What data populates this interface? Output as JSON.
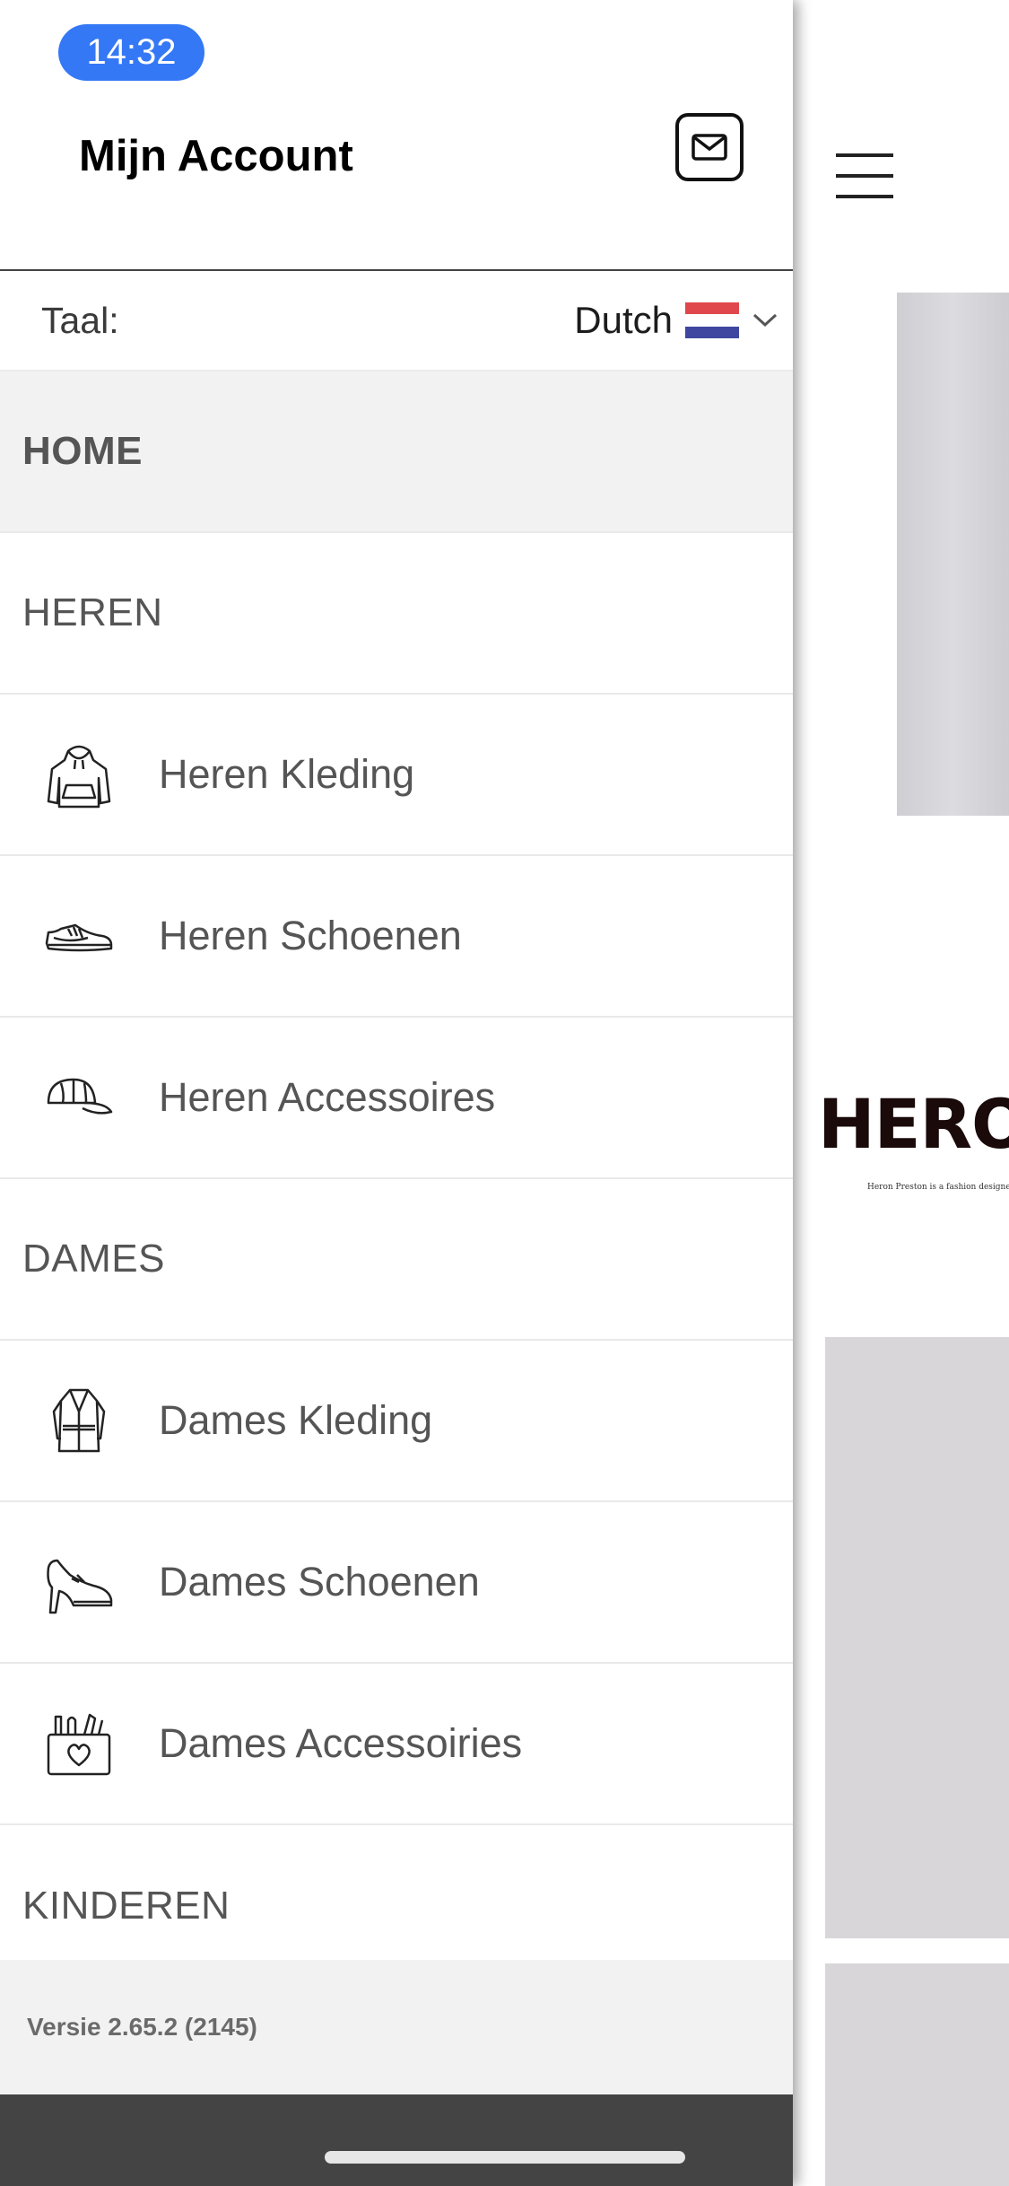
{
  "status_bar": {
    "time": "14:32"
  },
  "drawer": {
    "title": "Mijn Account",
    "language": {
      "label": "Taal:",
      "value": "Dutch",
      "flag": "nl-flag-icon"
    },
    "menu": {
      "home": "HOME",
      "heren": "HEREN",
      "heren_kleding": "Heren Kleding",
      "heren_schoenen": "Heren Schoenen",
      "heren_accessoires": "Heren Accessoires",
      "dames": "DAMES",
      "dames_kleding": "Dames Kleding",
      "dames_schoenen": "Dames Schoenen",
      "dames_accessoiries": "Dames Accessoiries",
      "kinderen": "KINDEREN"
    },
    "version": "Versie 2.65.2 (2145)"
  },
  "main": {
    "brand": "HERO",
    "tagline": "Heron Preston is a fashion designer who"
  },
  "colors": {
    "accent": "#3478f6",
    "active_row": "#f2f2f2",
    "footer": "#444444"
  }
}
